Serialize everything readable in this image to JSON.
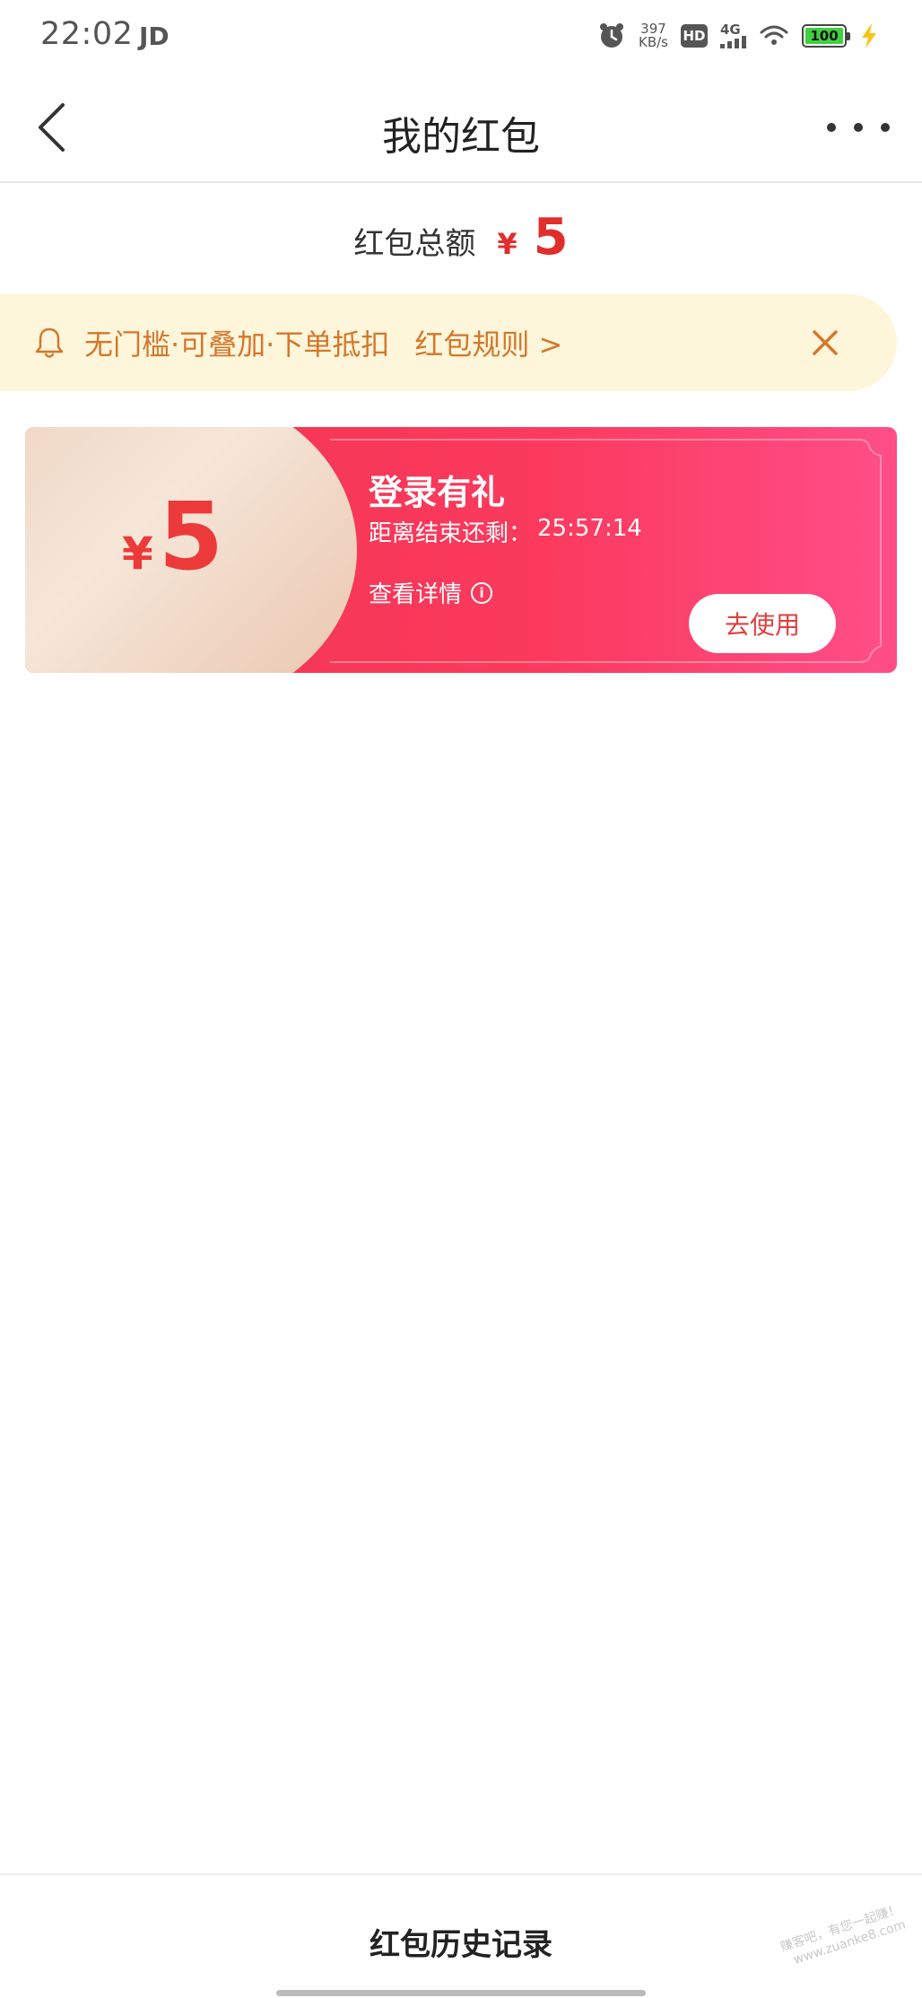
{
  "status_bar": {
    "time": "22:02",
    "app": "JD",
    "net_speed_value": "397",
    "net_speed_unit": "KB/s",
    "hd": "HD",
    "network": "4G",
    "battery": "100"
  },
  "header": {
    "title": "我的红包"
  },
  "total": {
    "label": "红包总额",
    "currency": "¥",
    "amount": "5"
  },
  "notice": {
    "text": "无门槛·可叠加·下单抵扣",
    "link": "红包规则 >"
  },
  "coupon": {
    "currency": "¥",
    "amount": "5",
    "title": "登录有礼",
    "countdown_label": "距离结束还剩：",
    "countdown_value": "25:57:14",
    "detail_label": "查看详情",
    "info_glyph": "i",
    "use_label": "去使用"
  },
  "bottom": {
    "history_label": "红包历史记录",
    "watermark_line1": "赚客吧，有您一起赚！",
    "watermark_line2": "www.zuanke8.com"
  },
  "colors": {
    "accent_red": "#e22d2d",
    "notice_bg": "#fdf6db",
    "notice_text": "#d4772b",
    "coupon_start": "#f2344f",
    "coupon_end": "#ff4e88"
  }
}
